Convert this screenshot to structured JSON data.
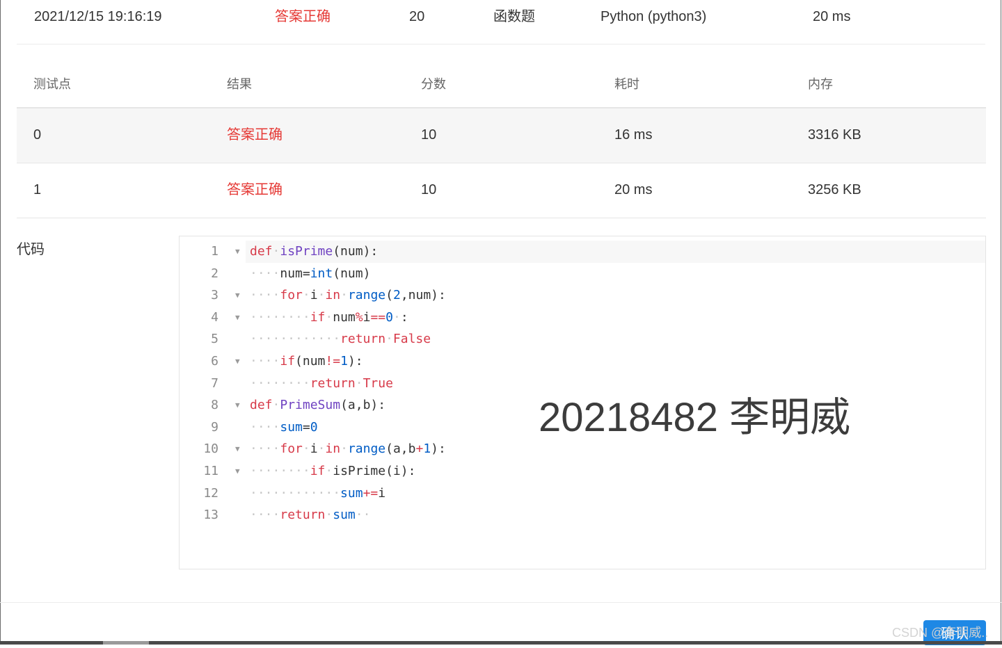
{
  "summary": {
    "submit_time": "2021/12/15 19:16:19",
    "status": "答案正确",
    "score": "20",
    "problem_type": "函数题",
    "compiler": "Python (python3)",
    "time": "20 ms"
  },
  "tests": {
    "headers": [
      "测试点",
      "结果",
      "分数",
      "耗时",
      "内存"
    ],
    "rows": [
      {
        "point": "0",
        "result": "答案正确",
        "score": "10",
        "time": "16 ms",
        "memory": "3316 KB"
      },
      {
        "point": "1",
        "result": "答案正确",
        "score": "10",
        "time": "20 ms",
        "memory": "3256 KB"
      }
    ]
  },
  "code": {
    "label": "代码",
    "lines": [
      {
        "n": "1"
      },
      {
        "n": "2"
      },
      {
        "n": "3"
      },
      {
        "n": "4"
      },
      {
        "n": "5"
      },
      {
        "n": "6"
      },
      {
        "n": "7"
      },
      {
        "n": "8"
      },
      {
        "n": "9"
      },
      {
        "n": "10"
      },
      {
        "n": "11"
      },
      {
        "n": "12"
      },
      {
        "n": "13"
      }
    ]
  },
  "overlay": "20218482 李明威",
  "footer": {
    "confirm_label": "确认",
    "watermark": "CSDN @李明威.."
  },
  "colors": {
    "accent_red": "#e53935",
    "confirm_blue": "#1e88e5"
  }
}
